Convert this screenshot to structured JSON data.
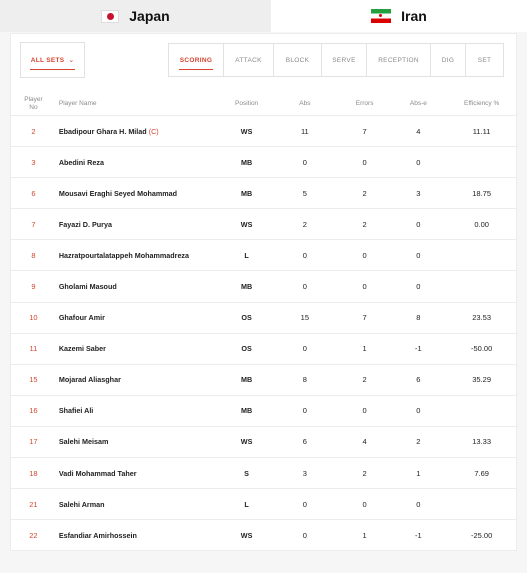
{
  "teams": [
    {
      "name": "Japan",
      "flag": "japan-flag",
      "active": false
    },
    {
      "name": "Iran",
      "flag": "iran-flag",
      "active": true
    }
  ],
  "filters": {
    "sets_label": "ALL SETS",
    "tabs": [
      "SCORING",
      "ATTACK",
      "BLOCK",
      "SERVE",
      "RECEPTION",
      "DIG",
      "SET"
    ],
    "active_tab": "SCORING"
  },
  "table": {
    "headers": {
      "player_no": "Player No",
      "player_name": "Player Name",
      "position": "Position",
      "abs": "Abs",
      "errors": "Errors",
      "abs_e": "Abs-e",
      "efficiency": "Efficiency %"
    },
    "rows": [
      {
        "no": "2",
        "name": "Ebadipour Ghara H. Milad",
        "captain": "(C)",
        "pos": "WS",
        "abs": "11",
        "err": "7",
        "abse": "4",
        "eff": "11.11"
      },
      {
        "no": "3",
        "name": "Abedini Reza",
        "captain": "",
        "pos": "MB",
        "abs": "0",
        "err": "0",
        "abse": "0",
        "eff": ""
      },
      {
        "no": "6",
        "name": "Mousavi Eraghi Seyed Mohammad",
        "captain": "",
        "pos": "MB",
        "abs": "5",
        "err": "2",
        "abse": "3",
        "eff": "18.75"
      },
      {
        "no": "7",
        "name": "Fayazi D. Purya",
        "captain": "",
        "pos": "WS",
        "abs": "2",
        "err": "2",
        "abse": "0",
        "eff": "0.00"
      },
      {
        "no": "8",
        "name": "Hazratpourtalatappeh Mohammadreza",
        "captain": "",
        "pos": "L",
        "abs": "0",
        "err": "0",
        "abse": "0",
        "eff": ""
      },
      {
        "no": "9",
        "name": "Gholami Masoud",
        "captain": "",
        "pos": "MB",
        "abs": "0",
        "err": "0",
        "abse": "0",
        "eff": ""
      },
      {
        "no": "10",
        "name": "Ghafour Amir",
        "captain": "",
        "pos": "OS",
        "abs": "15",
        "err": "7",
        "abse": "8",
        "eff": "23.53"
      },
      {
        "no": "11",
        "name": "Kazemi Saber",
        "captain": "",
        "pos": "OS",
        "abs": "0",
        "err": "1",
        "abse": "-1",
        "eff": "-50.00"
      },
      {
        "no": "15",
        "name": "Mojarad Aliasghar",
        "captain": "",
        "pos": "MB",
        "abs": "8",
        "err": "2",
        "abse": "6",
        "eff": "35.29"
      },
      {
        "no": "16",
        "name": "Shafiei Ali",
        "captain": "",
        "pos": "MB",
        "abs": "0",
        "err": "0",
        "abse": "0",
        "eff": ""
      },
      {
        "no": "17",
        "name": "Salehi Meisam",
        "captain": "",
        "pos": "WS",
        "abs": "6",
        "err": "4",
        "abse": "2",
        "eff": "13.33"
      },
      {
        "no": "18",
        "name": "Vadi Mohammad Taher",
        "captain": "",
        "pos": "S",
        "abs": "3",
        "err": "2",
        "abse": "1",
        "eff": "7.69"
      },
      {
        "no": "21",
        "name": "Salehi Arman",
        "captain": "",
        "pos": "L",
        "abs": "0",
        "err": "0",
        "abse": "0",
        "eff": ""
      },
      {
        "no": "22",
        "name": "Esfandiar Amirhossein",
        "captain": "",
        "pos": "WS",
        "abs": "0",
        "err": "1",
        "abse": "-1",
        "eff": "-25.00"
      }
    ]
  },
  "colors": {
    "accent": "#d6452f",
    "muted_text": "#8a8a8a",
    "border": "#ececec"
  }
}
